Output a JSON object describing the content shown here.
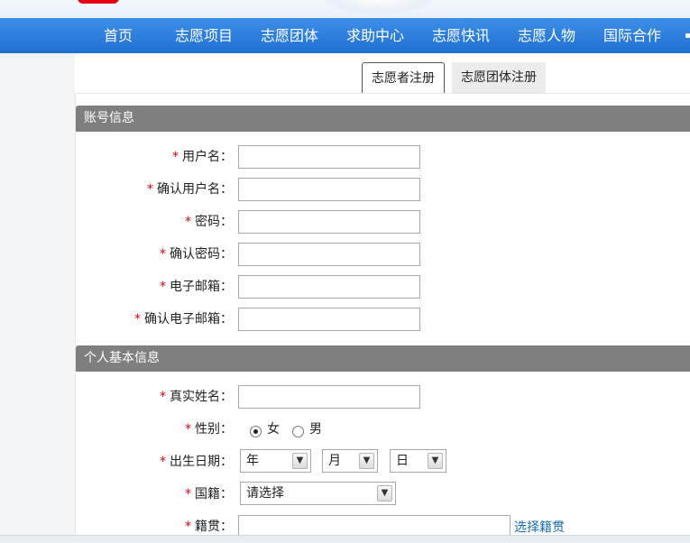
{
  "nav": {
    "items": [
      "首页",
      "志愿项目",
      "志愿团体",
      "求助中心",
      "志愿快讯",
      "志愿人物",
      "国际合作"
    ]
  },
  "tabs": {
    "volunteer": "志愿者注册",
    "group": "志愿团体注册"
  },
  "sections": {
    "account": "账号信息",
    "personal": "个人基本信息"
  },
  "form": {
    "required_mark": "*",
    "username": "用户名：",
    "confirm_username": "确认用户名：",
    "password": "密码：",
    "confirm_password": "确认密码：",
    "email": "电子邮箱：",
    "confirm_email": "确认电子邮箱：",
    "real_name": "真实姓名：",
    "gender": "性别：",
    "gender_female": "女",
    "gender_male": "男",
    "gender_selected": "女",
    "birthdate": "出生日期：",
    "year_selected": "年",
    "month_selected": "月",
    "day_selected": "日",
    "nationality": "国籍：",
    "nationality_selected": "请选择",
    "native_place": "籍贯：",
    "choose_native_place": "选择籍贯"
  },
  "colors": {
    "nav_bg": "#2a7ddc",
    "section_bg": "#7f7f7f",
    "required": "#e60012",
    "link": "#1a6fb5"
  },
  "icons": {
    "dropdown": "chevron-down-icon"
  }
}
